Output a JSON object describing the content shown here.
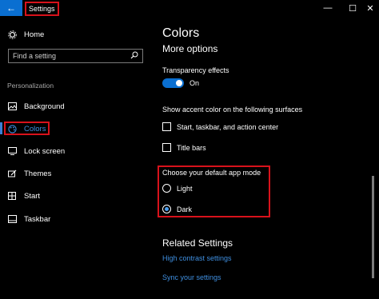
{
  "titlebar": {
    "title": "Settings",
    "back_icon": "←",
    "minimize": "—",
    "maximize": "☐",
    "close": "✕"
  },
  "nav": {
    "home": "Home",
    "search_placeholder": "Find a setting",
    "section": "Personalization",
    "items": [
      {
        "label": "Background",
        "icon": "picture-icon"
      },
      {
        "label": "Colors",
        "icon": "palette-icon",
        "active": true
      },
      {
        "label": "Lock screen",
        "icon": "monitor-icon"
      },
      {
        "label": "Themes",
        "icon": "brush-icon"
      },
      {
        "label": "Start",
        "icon": "start-icon"
      },
      {
        "label": "Taskbar",
        "icon": "taskbar-icon"
      }
    ]
  },
  "main": {
    "title": "Colors",
    "subtitle": "More options",
    "transparency_label": "Transparency effects",
    "transparency_state": "On",
    "accent_label": "Show accent color on the following surfaces",
    "checkboxes": [
      "Start, taskbar, and action center",
      "Title bars"
    ],
    "mode_label": "Choose your default app mode",
    "modes": [
      "Light",
      "Dark"
    ],
    "selected_mode": "Dark",
    "related_title": "Related Settings",
    "links": [
      "High contrast settings",
      "Sync your settings"
    ]
  },
  "colors": {
    "accent": "#0a6fd1",
    "highlight": "#d8121b",
    "link": "#3f8fe0"
  }
}
